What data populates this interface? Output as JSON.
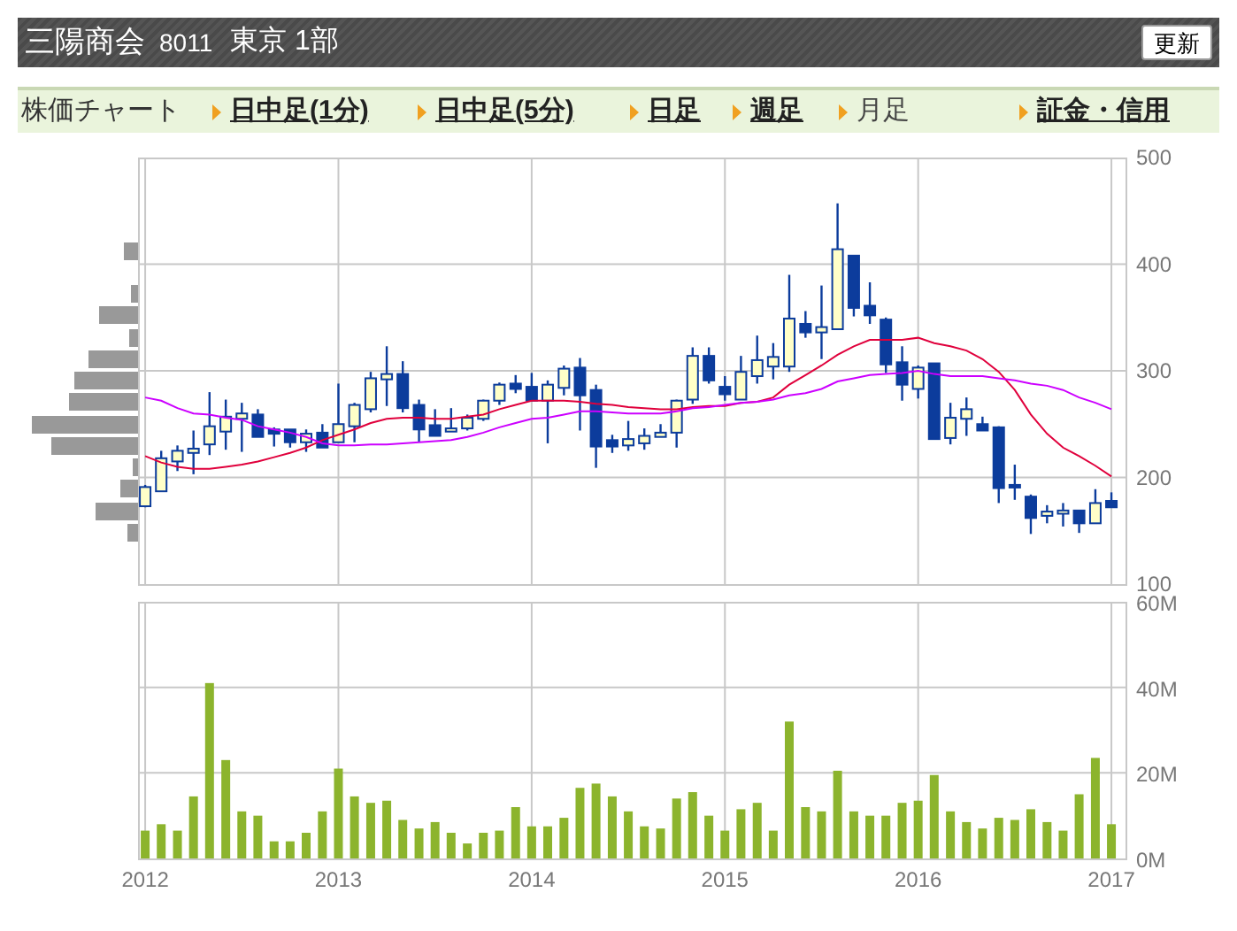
{
  "header": {
    "company": "三陽商会",
    "code": "8011",
    "market": "東京 1部",
    "refresh_button": "更新"
  },
  "nav": {
    "label": "株価チャート",
    "tabs": [
      {
        "label": "日中足(1分)",
        "selected": false
      },
      {
        "label": "日中足(5分)",
        "selected": false
      },
      {
        "label": "日足",
        "selected": false
      },
      {
        "label": "週足",
        "selected": false
      },
      {
        "label": "月足",
        "selected": true
      },
      {
        "label": "証金・信用",
        "selected": false
      }
    ]
  },
  "price_chart": {
    "chart_data": {
      "type": "candlestick",
      "grid": true,
      "ylim": [
        100,
        500
      ],
      "yticks": [
        100,
        200,
        300,
        400,
        500
      ],
      "x": [
        2012,
        2012.083,
        2012.167,
        2012.25,
        2012.333,
        2012.417,
        2012.5,
        2012.583,
        2012.667,
        2012.75,
        2012.833,
        2012.917,
        2013,
        2013.083,
        2013.167,
        2013.25,
        2013.333,
        2013.417,
        2013.5,
        2013.583,
        2013.667,
        2013.75,
        2013.833,
        2013.917,
        2014,
        2014.083,
        2014.167,
        2014.25,
        2014.333,
        2014.417,
        2014.5,
        2014.583,
        2014.667,
        2014.75,
        2014.833,
        2014.917,
        2015,
        2015.083,
        2015.167,
        2015.25,
        2015.333,
        2015.417,
        2015.5,
        2015.583,
        2015.667,
        2015.75,
        2015.833,
        2015.917,
        2016,
        2016.083,
        2016.167,
        2016.25,
        2016.333,
        2016.417,
        2016.5,
        2016.583,
        2016.667,
        2016.75,
        2016.833,
        2016.917,
        2017
      ],
      "xlim": [
        2011.963,
        2017.073
      ],
      "ohlc": [
        [
          173,
          193,
          172,
          191
        ],
        [
          187,
          225,
          187,
          218
        ],
        [
          215,
          230,
          206,
          225
        ],
        [
          223,
          244,
          203,
          227
        ],
        [
          231,
          280,
          221,
          248
        ],
        [
          243,
          273,
          226,
          257
        ],
        [
          255,
          270,
          224,
          260
        ],
        [
          259,
          264,
          238,
          238
        ],
        [
          245,
          247,
          229,
          241
        ],
        [
          245,
          245,
          228,
          233
        ],
        [
          233,
          245,
          224,
          241
        ],
        [
          242,
          250,
          228,
          228
        ],
        [
          233,
          288,
          233,
          250
        ],
        [
          248,
          270,
          233,
          268
        ],
        [
          264,
          299,
          261,
          293
        ],
        [
          292,
          323,
          267,
          297
        ],
        [
          297,
          309,
          261,
          265
        ],
        [
          268,
          273,
          233,
          245
        ],
        [
          249,
          264,
          239,
          239
        ],
        [
          243,
          265,
          243,
          246
        ],
        [
          246,
          259,
          244,
          256
        ],
        [
          255,
          273,
          253,
          272
        ],
        [
          272,
          289,
          268,
          287
        ],
        [
          288,
          296,
          279,
          283
        ],
        [
          285,
          298,
          272,
          272
        ],
        [
          272,
          291,
          232,
          287
        ],
        [
          284,
          305,
          277,
          302
        ],
        [
          303,
          312,
          244,
          277
        ],
        [
          282,
          287,
          209,
          229
        ],
        [
          235,
          240,
          223,
          229
        ],
        [
          230,
          253,
          225,
          236
        ],
        [
          232,
          246,
          226,
          239
        ],
        [
          238,
          250,
          238,
          242
        ],
        [
          242,
          273,
          228,
          272
        ],
        [
          273,
          322,
          269,
          314
        ],
        [
          314,
          322,
          288,
          291
        ],
        [
          285,
          295,
          272,
          278
        ],
        [
          273,
          314,
          273,
          299
        ],
        [
          295,
          333,
          288,
          310
        ],
        [
          304,
          326,
          292,
          313
        ],
        [
          304,
          390,
          299,
          349
        ],
        [
          344,
          356,
          331,
          336
        ],
        [
          336,
          380,
          311,
          341
        ],
        [
          339,
          457,
          339,
          414
        ],
        [
          408,
          408,
          351,
          359
        ],
        [
          361,
          383,
          344,
          352
        ],
        [
          348,
          350,
          298,
          306
        ],
        [
          308,
          323,
          272,
          287
        ],
        [
          283,
          305,
          274,
          303
        ],
        [
          307,
          307,
          236,
          236
        ],
        [
          237,
          270,
          231,
          256
        ],
        [
          255,
          275,
          239,
          264
        ],
        [
          250,
          257,
          244,
          244
        ],
        [
          247,
          248,
          176,
          190
        ],
        [
          193,
          212,
          179,
          192
        ],
        [
          182,
          184,
          147,
          162
        ],
        [
          164,
          174,
          157,
          168
        ],
        [
          166,
          176,
          154,
          169
        ],
        [
          169,
          169,
          148,
          157
        ],
        [
          157,
          189,
          157,
          176
        ],
        [
          178,
          186,
          172,
          172
        ]
      ]
    },
    "moving_averages": {
      "chart_data": {
        "type": "line",
        "ylim": [
          100,
          500
        ],
        "xlim": [
          2011.963,
          2017.073
        ],
        "x": [
          2012,
          2012.083,
          2012.167,
          2012.25,
          2012.333,
          2012.417,
          2012.5,
          2012.583,
          2012.667,
          2012.75,
          2012.833,
          2012.917,
          2013,
          2013.083,
          2013.167,
          2013.25,
          2013.333,
          2013.417,
          2013.5,
          2013.583,
          2013.667,
          2013.75,
          2013.833,
          2013.917,
          2014,
          2014.083,
          2014.167,
          2014.25,
          2014.333,
          2014.417,
          2014.5,
          2014.583,
          2014.667,
          2014.75,
          2014.833,
          2014.917,
          2015,
          2015.083,
          2015.167,
          2015.25,
          2015.333,
          2015.417,
          2015.5,
          2015.583,
          2015.667,
          2015.75,
          2015.833,
          2015.917,
          2016,
          2016.083,
          2016.167,
          2016.25,
          2016.333,
          2016.417,
          2016.5,
          2016.583,
          2016.667,
          2016.75,
          2016.833,
          2016.917,
          2017
        ],
        "series": [
          {
            "color": "#e0003c",
            "values": [
              220,
              214,
              210,
              208,
              208,
              210,
              212,
              215,
              219,
              223,
              228,
              235,
              240,
              245,
              251,
              255,
              256,
              256,
              255,
              255,
              257,
              259,
              264,
              268,
              272,
              272,
              272,
              271,
              269,
              268,
              266,
              265,
              264,
              264,
              266,
              267,
              267,
              270,
              271,
              275,
              287,
              296,
              305,
              315,
              323,
              329,
              329,
              329,
              331,
              326,
              323,
              319,
              311,
              299,
              282,
              259,
              241,
              228,
              220,
              211,
              201
            ]
          },
          {
            "color": "#cc00ff",
            "values": [
              275,
              272,
              265,
              260,
              259,
              256,
              254,
              248,
              245,
              242,
              238,
              232,
              230,
              230,
              231,
              231,
              232,
              233,
              234,
              235,
              238,
              242,
              247,
              251,
              255,
              256,
              259,
              262,
              262,
              261,
              260,
              260,
              260,
              262,
              265,
              266,
              268,
              270,
              271,
              273,
              277,
              279,
              283,
              290,
              293,
              296,
              297,
              298,
              300,
              297,
              295,
              295,
              295,
              293,
              291,
              288,
              286,
              282,
              275,
              270,
              264
            ]
          }
        ]
      }
    }
  },
  "volume_chart": {
    "chart_data": {
      "type": "bar",
      "grid": true,
      "ylim": [
        0,
        60
      ],
      "xlim": [
        2011.963,
        2017.073
      ],
      "yticks": [
        {
          "value": 0,
          "label": "0M"
        },
        {
          "value": 20,
          "label": "20M"
        },
        {
          "value": 40,
          "label": "40M"
        },
        {
          "value": 60,
          "label": "60M"
        }
      ],
      "x": [
        2012,
        2012.083,
        2012.167,
        2012.25,
        2012.333,
        2012.417,
        2012.5,
        2012.583,
        2012.667,
        2012.75,
        2012.833,
        2012.917,
        2013,
        2013.083,
        2013.167,
        2013.25,
        2013.333,
        2013.417,
        2013.5,
        2013.583,
        2013.667,
        2013.75,
        2013.833,
        2013.917,
        2014,
        2014.083,
        2014.167,
        2014.25,
        2014.333,
        2014.417,
        2014.5,
        2014.583,
        2014.667,
        2014.75,
        2014.833,
        2014.917,
        2015,
        2015.083,
        2015.167,
        2015.25,
        2015.333,
        2015.417,
        2015.5,
        2015.583,
        2015.667,
        2015.75,
        2015.833,
        2015.917,
        2016,
        2016.083,
        2016.167,
        2016.25,
        2016.333,
        2016.417,
        2016.5,
        2016.583,
        2016.667,
        2016.75,
        2016.833,
        2016.917,
        2017
      ],
      "xticks": [
        2012,
        2013,
        2014,
        2015,
        2016,
        2017
      ],
      "series": [
        {
          "color": "#8cb42d",
          "values": [
            6.5,
            8,
            6.5,
            14.5,
            41,
            23,
            11,
            10,
            4,
            4,
            6,
            11,
            21,
            14.5,
            13,
            13.5,
            9,
            7,
            8.5,
            6,
            3.5,
            6,
            6.5,
            12,
            7.5,
            7.5,
            9.5,
            16.5,
            17.5,
            14.5,
            11,
            7.5,
            7,
            14,
            15.5,
            10,
            6.5,
            11.5,
            13,
            6.5,
            32,
            12,
            11,
            20.5,
            11,
            10,
            10,
            13,
            13.5,
            19.5,
            11,
            8.5,
            7,
            9.5,
            9,
            11.5,
            8.5,
            6.5,
            15,
            23.5,
            8
          ]
        }
      ]
    }
  }
}
